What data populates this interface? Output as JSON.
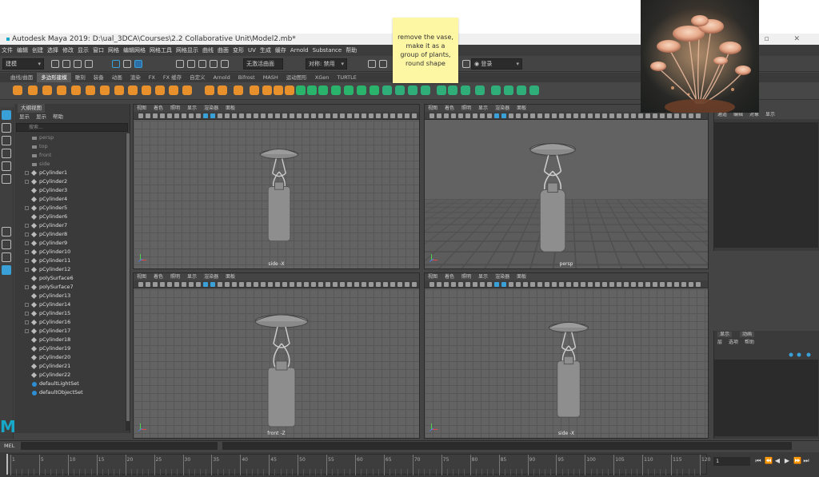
{
  "window": {
    "title": "Autodesk Maya 2019: D:\\ual_3DCA\\Courses\\2.2 Collaborative Unit\\Model2.mb*",
    "controls": "–  ▫  ✕"
  },
  "menubar": [
    "文件",
    "编辑",
    "创建",
    "选择",
    "修改",
    "显示",
    "窗口",
    "网格",
    "编辑网格",
    "网格工具",
    "网格显示",
    "曲线",
    "曲面",
    "变形",
    "UV",
    "生成",
    "缓存",
    "Arnold",
    "Substance",
    "帮助"
  ],
  "statusline": {
    "mode": "建模",
    "live_surface": "无激活曲面",
    "symmetry": "对称: 禁用",
    "login": "登录"
  },
  "shelf_tabs": [
    "曲线/曲面",
    "多边形建模",
    "雕刻",
    "装备",
    "动画",
    "渲染",
    "FX",
    "FX 缓存",
    "自定义",
    "Arnold",
    "Bifrost",
    "MASH",
    "运动图形",
    "XGen",
    "TURTLE"
  ],
  "shelf_active": "多边形建模",
  "outliner": {
    "title": "大纲视图",
    "menu": [
      "显示",
      "显示",
      "帮助"
    ],
    "search_placeholder": "搜索...",
    "items": [
      {
        "name": "persp",
        "type": "camera"
      },
      {
        "name": "top",
        "type": "camera"
      },
      {
        "name": "front",
        "type": "camera"
      },
      {
        "name": "side",
        "type": "camera"
      },
      {
        "name": "pCylinder1",
        "type": "mesh",
        "expandable": true
      },
      {
        "name": "pCylinder2",
        "type": "mesh",
        "expandable": true
      },
      {
        "name": "pCylinder3",
        "type": "mesh",
        "expandable": false
      },
      {
        "name": "pCylinder4",
        "type": "mesh",
        "expandable": false
      },
      {
        "name": "pCylinder5",
        "type": "mesh",
        "expandable": true
      },
      {
        "name": "pCylinder6",
        "type": "mesh",
        "expandable": false
      },
      {
        "name": "pCylinder7",
        "type": "mesh",
        "expandable": true
      },
      {
        "name": "pCylinder8",
        "type": "mesh",
        "expandable": true
      },
      {
        "name": "pCylinder9",
        "type": "mesh",
        "expandable": true
      },
      {
        "name": "pCylinder10",
        "type": "mesh",
        "expandable": true
      },
      {
        "name": "pCylinder11",
        "type": "mesh",
        "expandable": true
      },
      {
        "name": "pCylinder12",
        "type": "mesh",
        "expandable": true
      },
      {
        "name": "polySurface6",
        "type": "mesh",
        "expandable": false
      },
      {
        "name": "polySurface7",
        "type": "mesh",
        "expandable": true
      },
      {
        "name": "pCylinder13",
        "type": "mesh",
        "expandable": false
      },
      {
        "name": "pCylinder14",
        "type": "mesh",
        "expandable": true
      },
      {
        "name": "pCylinder15",
        "type": "mesh",
        "expandable": true
      },
      {
        "name": "pCylinder16",
        "type": "mesh",
        "expandable": true
      },
      {
        "name": "pCylinder17",
        "type": "mesh",
        "expandable": true
      },
      {
        "name": "pCylinder18",
        "type": "mesh",
        "expandable": false
      },
      {
        "name": "pCylinder19",
        "type": "mesh",
        "expandable": false
      },
      {
        "name": "pCylinder20",
        "type": "mesh",
        "expandable": false
      },
      {
        "name": "pCylinder21",
        "type": "mesh",
        "expandable": false
      },
      {
        "name": "pCylinder22",
        "type": "mesh",
        "expandable": false
      },
      {
        "name": "defaultLightSet",
        "type": "set",
        "expandable": false
      },
      {
        "name": "defaultObjectSet",
        "type": "set",
        "expandable": false
      }
    ]
  },
  "viewports": [
    {
      "id": "side",
      "label": "side -X",
      "menu": [
        "视图",
        "着色",
        "照明",
        "显示",
        "渲染器",
        "面板"
      ]
    },
    {
      "id": "persp",
      "label": "persp",
      "menu": [
        "视图",
        "着色",
        "照明",
        "显示",
        "渲染器",
        "面板"
      ]
    },
    {
      "id": "front",
      "label": "front -Z",
      "menu": [
        "视图",
        "着色",
        "照明",
        "显示",
        "渲染器",
        "面板"
      ]
    },
    {
      "id": "sidex",
      "label": "side -X",
      "menu": [
        "视图",
        "着色",
        "照明",
        "显示",
        "渲染器",
        "面板"
      ]
    }
  ],
  "attribute_panel": {
    "tabs": [
      "通道",
      "编辑",
      "对象",
      "显示"
    ]
  },
  "layer_panel": {
    "tabs": [
      "显示",
      "动画"
    ],
    "menu": [
      "层",
      "选项",
      "帮助"
    ]
  },
  "command_line": {
    "label": "MEL"
  },
  "timeline": {
    "ticks": [
      "1",
      "5",
      "10",
      "15",
      "20",
      "25",
      "30",
      "35",
      "40",
      "45",
      "50",
      "55",
      "60",
      "65",
      "70",
      "75",
      "80",
      "85",
      "90",
      "95",
      "100",
      "105",
      "110",
      "115",
      "120"
    ],
    "current_frame": "1",
    "controls": [
      "⏮",
      "⏪",
      "◀",
      "▶",
      "⏩",
      "⏭"
    ]
  },
  "sticky_note": {
    "text": "remove the vase, make it as a group of plants, round shape"
  },
  "colors": {
    "accent": "#17a8c9",
    "sticky": "#fdf6a3",
    "shelf_orange": "#e8902b",
    "shelf_green": "#29b36b"
  }
}
